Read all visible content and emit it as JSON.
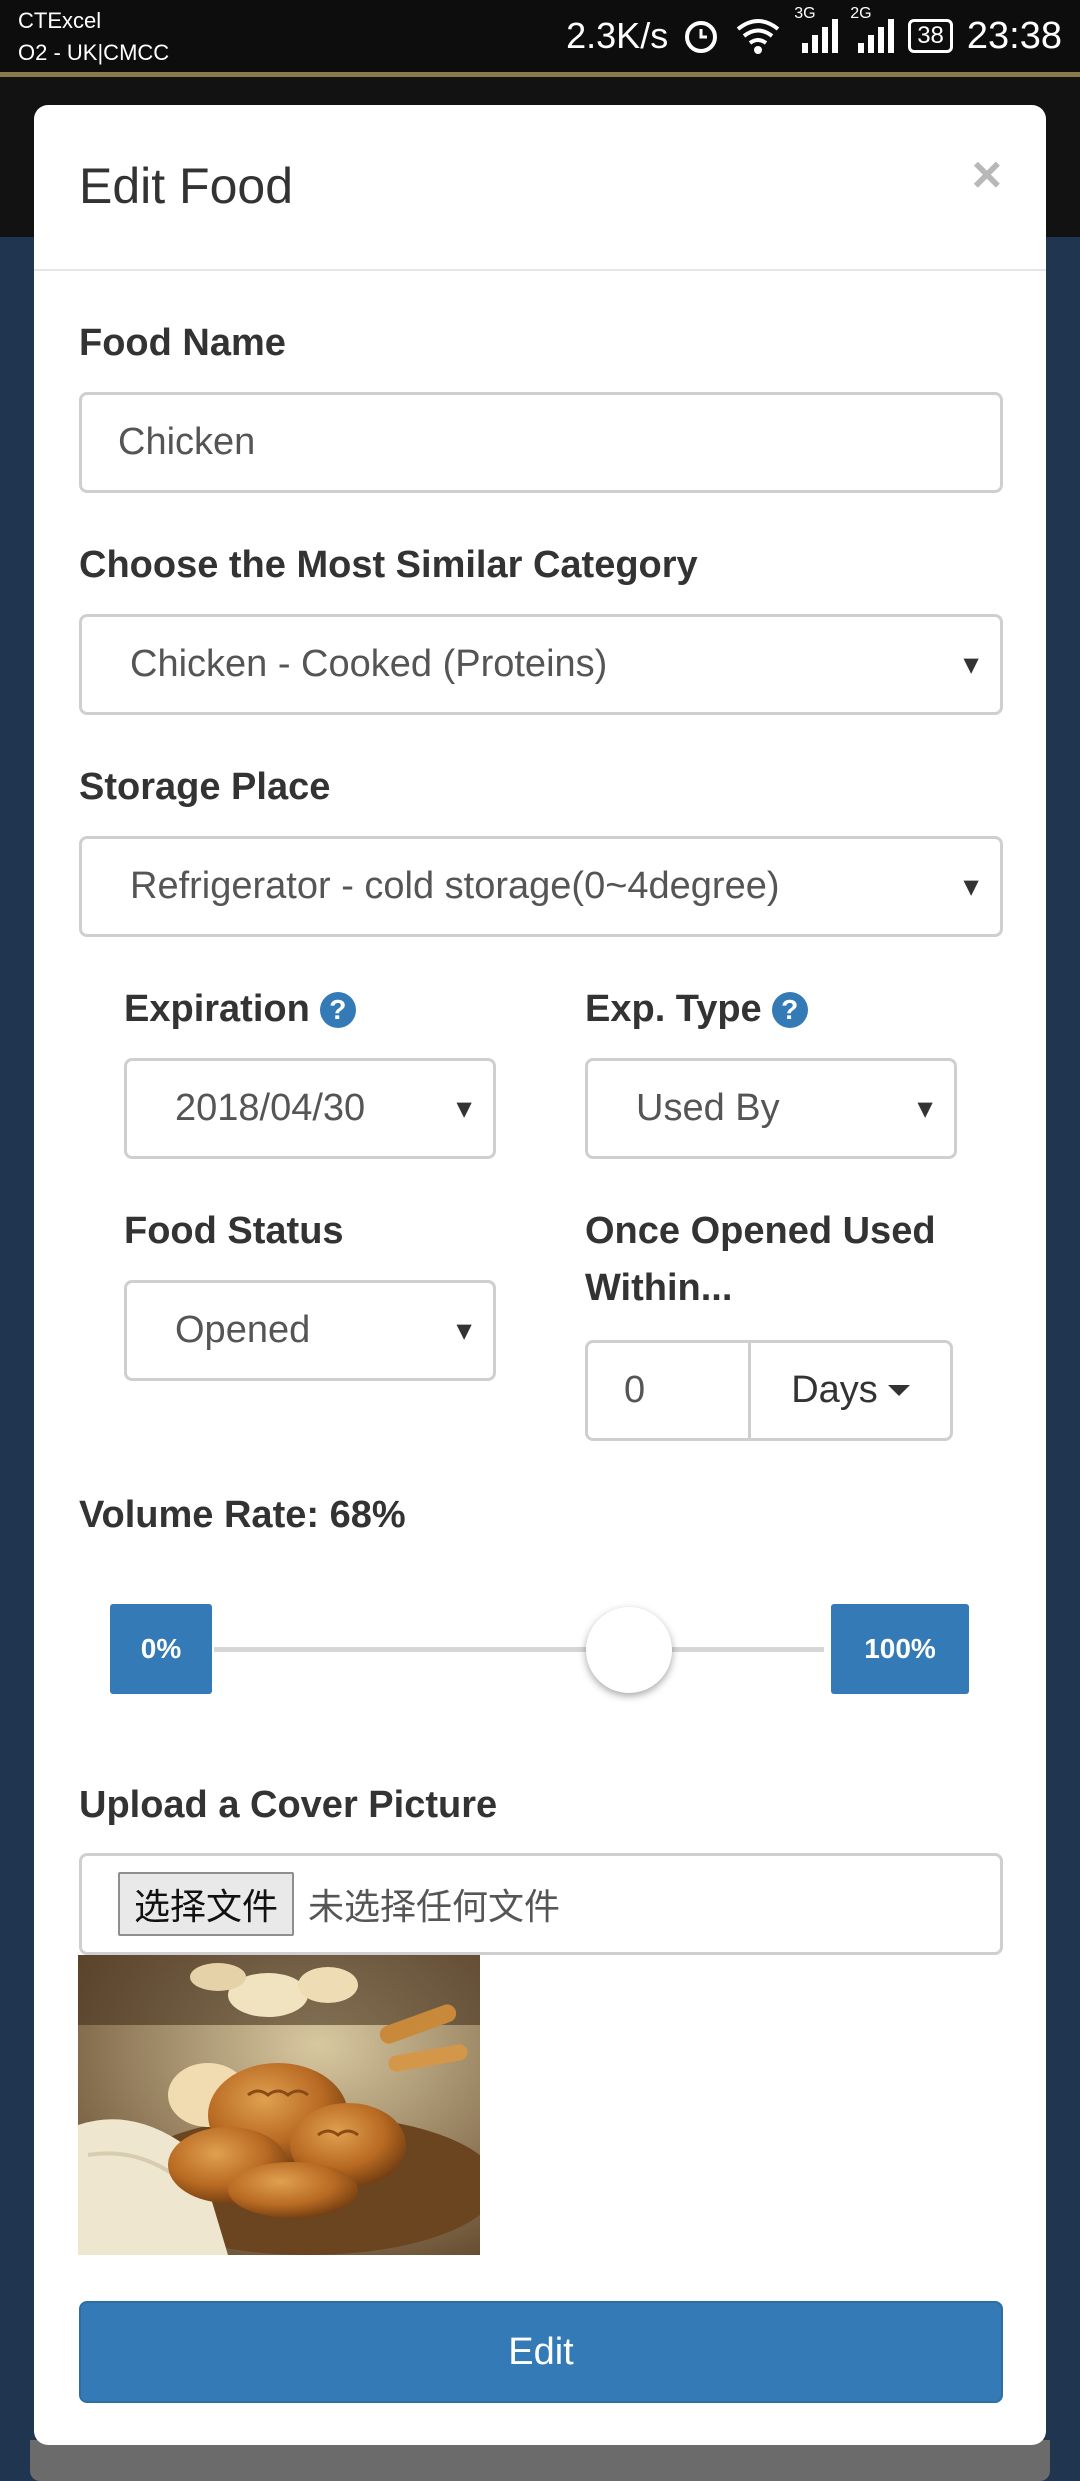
{
  "status_bar": {
    "carrier_line1": "CTExcel",
    "carrier_line2": "O2 - UK|CMCC",
    "speed": "2.3K/s",
    "net1": "3G",
    "net2": "2G",
    "battery": "38",
    "time": "23:38"
  },
  "modal": {
    "title": "Edit Food",
    "close": "×"
  },
  "form": {
    "food_name_label": "Food Name",
    "food_name_value": "Chicken",
    "category_label": "Choose the Most Similar Category",
    "category_value": "Chicken - Cooked (Proteins)",
    "storage_label": "Storage Place",
    "storage_value": "Refrigerator - cold storage(0~4degree)",
    "expiration_label": "Expiration",
    "expiration_value": "2018/04/30",
    "exp_type_label": "Exp. Type",
    "exp_type_value": "Used By",
    "food_status_label": "Food Status",
    "food_status_value": "Opened",
    "once_opened_label_1": "Once Opened Used",
    "once_opened_label_2": "Within...",
    "once_opened_value": "0",
    "once_opened_unit": "Days",
    "volume_label": "Volume Rate: 68%",
    "volume_min": "0%",
    "volume_max": "100%",
    "volume_fraction": 0.68,
    "upload_label": "Upload a Cover Picture",
    "file_button": "选择文件",
    "file_status": "未选择任何文件",
    "submit": "Edit"
  },
  "colors": {
    "primary": "#337ab7"
  }
}
